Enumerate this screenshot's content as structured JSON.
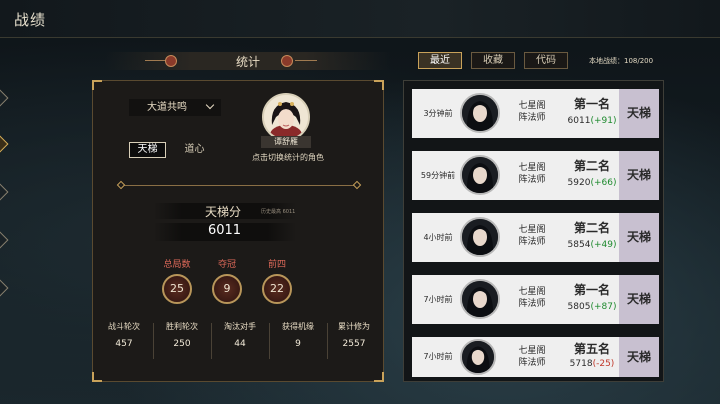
{
  "header": {
    "title": "战绩"
  },
  "stats": {
    "title": "统计",
    "dropdown_value": "大道共鸣",
    "tabs": [
      "天梯",
      "道心"
    ],
    "character_name": "谭舒雁",
    "avatar_hint": "点击切换统计的角色",
    "score_label": "天梯分",
    "score_history": "历史最高 6011",
    "score_value": "6011",
    "medals": [
      {
        "label": "总局数",
        "value": "25"
      },
      {
        "label": "夺冠",
        "value": "9"
      },
      {
        "label": "前四",
        "value": "22"
      }
    ],
    "bottom": [
      {
        "label": "战斗轮次",
        "value": "457"
      },
      {
        "label": "胜利轮次",
        "value": "250"
      },
      {
        "label": "淘汰对手",
        "value": "44"
      },
      {
        "label": "获得机缘",
        "value": "9"
      },
      {
        "label": "累计修为",
        "value": "2557"
      }
    ]
  },
  "records": {
    "tabs": [
      "最近",
      "收藏",
      "代码"
    ],
    "local_count": "本地战绩：108/200",
    "items": [
      {
        "time": "3分钟前",
        "sect": "七星阁",
        "role": "阵法师",
        "rank": "第一名",
        "score": "6011",
        "delta": "(+91)",
        "mode": "天梯"
      },
      {
        "time": "59分钟前",
        "sect": "七星阁",
        "role": "阵法师",
        "rank": "第二名",
        "score": "5920",
        "delta": "(+66)",
        "mode": "天梯"
      },
      {
        "time": "4小时前",
        "sect": "七星阁",
        "role": "阵法师",
        "rank": "第二名",
        "score": "5854",
        "delta": "(+49)",
        "mode": "天梯"
      },
      {
        "time": "7小时前",
        "sect": "七星阁",
        "role": "阵法师",
        "rank": "第一名",
        "score": "5805",
        "delta": "(+87)",
        "mode": "天梯"
      },
      {
        "time": "7小时前",
        "sect": "七星阁",
        "role": "阵法师",
        "rank": "第五名",
        "score": "5718",
        "delta": "(-25)",
        "mode": "天梯"
      }
    ]
  }
}
